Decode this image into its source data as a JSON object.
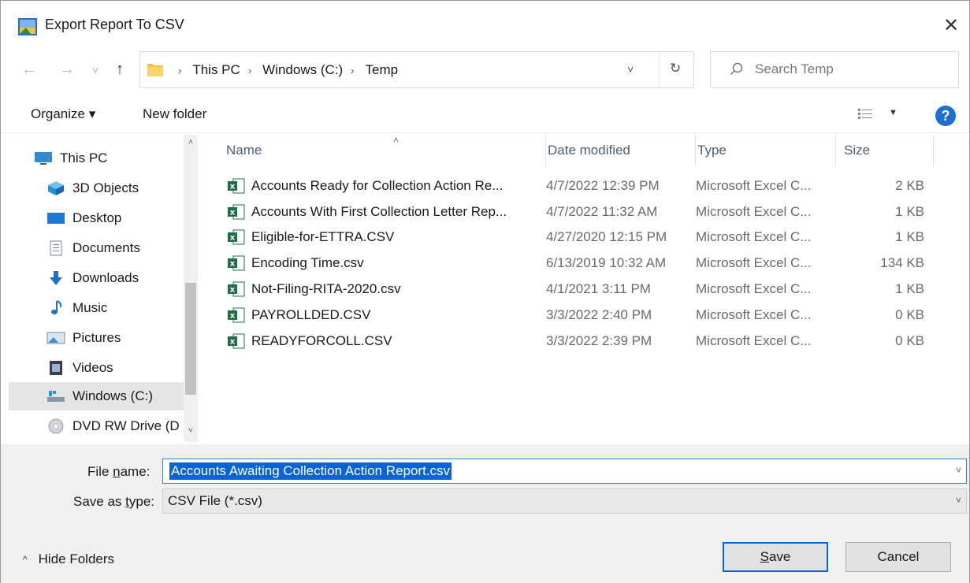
{
  "window": {
    "title": "Export Report To CSV",
    "close_glyph": "✕"
  },
  "nav": {
    "back_glyph": "←",
    "forward_glyph": "→",
    "recent_glyph": "˅",
    "up_glyph": "↑",
    "breadcrumbs": [
      "This PC",
      "Windows (C:)",
      "Temp"
    ],
    "separator": "›",
    "dropdown_glyph": "˅",
    "refresh_glyph": "↻",
    "search_placeholder": "Search Temp"
  },
  "commandbar": {
    "organize": "Organize ▾",
    "new_folder": "New folder",
    "views_caret": "▼",
    "help": "?"
  },
  "sidebar": {
    "items": [
      {
        "label": "This PC",
        "icon": "this-pc-icon"
      },
      {
        "label": "3D Objects",
        "icon": "3d-objects-icon"
      },
      {
        "label": "Desktop",
        "icon": "desktop-icon"
      },
      {
        "label": "Documents",
        "icon": "documents-icon"
      },
      {
        "label": "Downloads",
        "icon": "downloads-icon"
      },
      {
        "label": "Music",
        "icon": "music-icon"
      },
      {
        "label": "Pictures",
        "icon": "pictures-icon"
      },
      {
        "label": "Videos",
        "icon": "videos-icon"
      },
      {
        "label": "Windows (C:)",
        "icon": "drive-icon",
        "selected": true
      },
      {
        "label": "DVD RW Drive (D",
        "icon": "dvd-icon"
      }
    ],
    "scroll_up": "˄",
    "scroll_down": "˅"
  },
  "filelist": {
    "sort_glyph": "˄",
    "columns": [
      "Name",
      "Date modified",
      "Type",
      "Size"
    ],
    "rows": [
      {
        "name": "Accounts Ready for Collection Action Re...",
        "date": "4/7/2022 12:39 PM",
        "type": "Microsoft Excel C...",
        "size": "2 KB"
      },
      {
        "name": "Accounts With First Collection Letter Rep...",
        "date": "4/7/2022 11:32 AM",
        "type": "Microsoft Excel C...",
        "size": "1 KB"
      },
      {
        "name": "Eligible-for-ETTRA.CSV",
        "date": "4/27/2020 12:15 PM",
        "type": "Microsoft Excel C...",
        "size": "1 KB"
      },
      {
        "name": "Encoding Time.csv",
        "date": "6/13/2019 10:32 AM",
        "type": "Microsoft Excel C...",
        "size": "134 KB"
      },
      {
        "name": "Not-Filing-RITA-2020.csv",
        "date": "4/1/2021 3:11 PM",
        "type": "Microsoft Excel C...",
        "size": "1 KB"
      },
      {
        "name": "PAYROLLDED.CSV",
        "date": "3/3/2022 2:40 PM",
        "type": "Microsoft Excel C...",
        "size": "0 KB"
      },
      {
        "name": "READYFORCOLL.CSV",
        "date": "3/3/2022 2:39 PM",
        "type": "Microsoft Excel C...",
        "size": "0 KB"
      }
    ]
  },
  "footer": {
    "file_name_label_pre": "File ",
    "file_name_label_u": "n",
    "file_name_label_post": "ame:",
    "file_name_value": "Accounts Awaiting Collection Action Report.csv",
    "save_type_label_pre": "Save as ",
    "save_type_label_u": "t",
    "save_type_label_post": "ype:",
    "save_type_value": "CSV File (*.csv)",
    "combo_glyph": "˅",
    "hide_folders_caret": "^",
    "hide_folders": "Hide Folders",
    "save_u": "S",
    "save_rest": "ave",
    "cancel": "Cancel"
  },
  "colors": {
    "accent": "#0b64d6",
    "excel_green": "#1e7145",
    "help_blue": "#1d6fd2",
    "folder_yellow": "#f5c542"
  }
}
